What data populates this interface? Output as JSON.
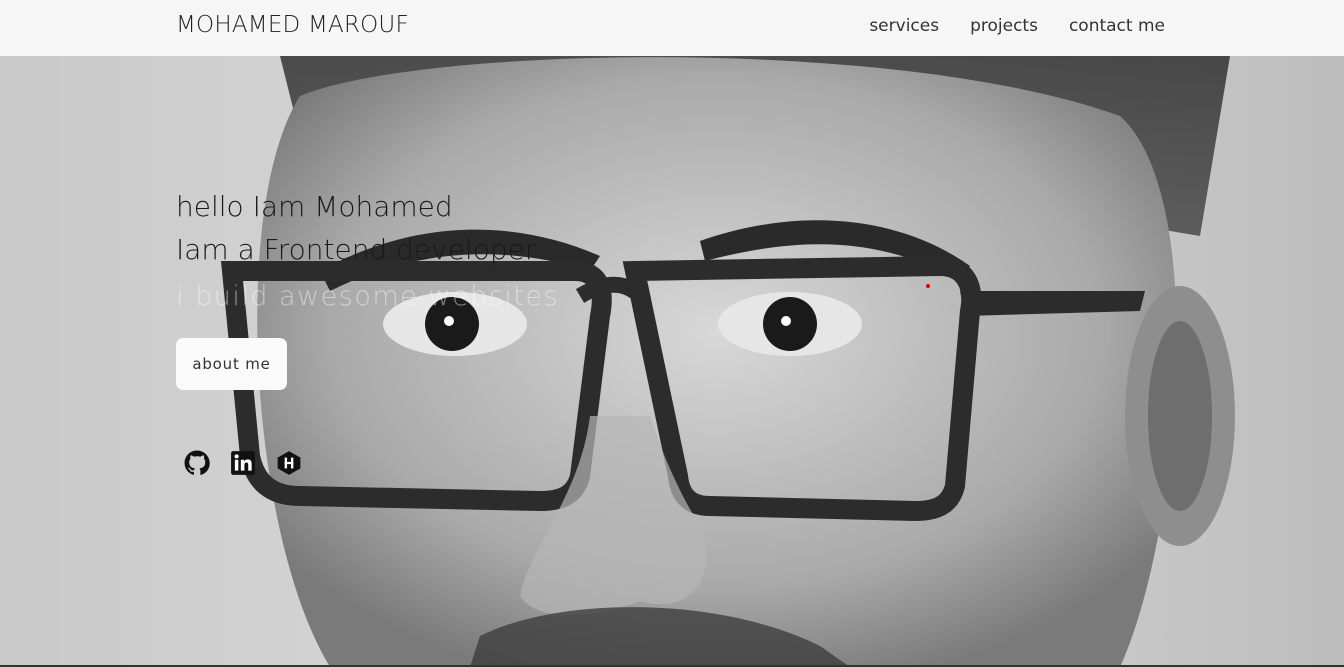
{
  "nav": {
    "brand": "MOHAMED MAROUF",
    "links": [
      "services",
      "projects",
      "contact me"
    ]
  },
  "hero": {
    "line1": "hello Iam Mohamed",
    "line2": "Iam a Frontend developer",
    "tagline": "i build awesome websites",
    "button": "about me"
  },
  "socials": [
    "github-icon",
    "linkedin-icon",
    "hashnode-icon"
  ],
  "colors": {
    "navbar": "#f6f6f6",
    "text": "#1a1a1a",
    "button_bg": "#fafafa"
  }
}
